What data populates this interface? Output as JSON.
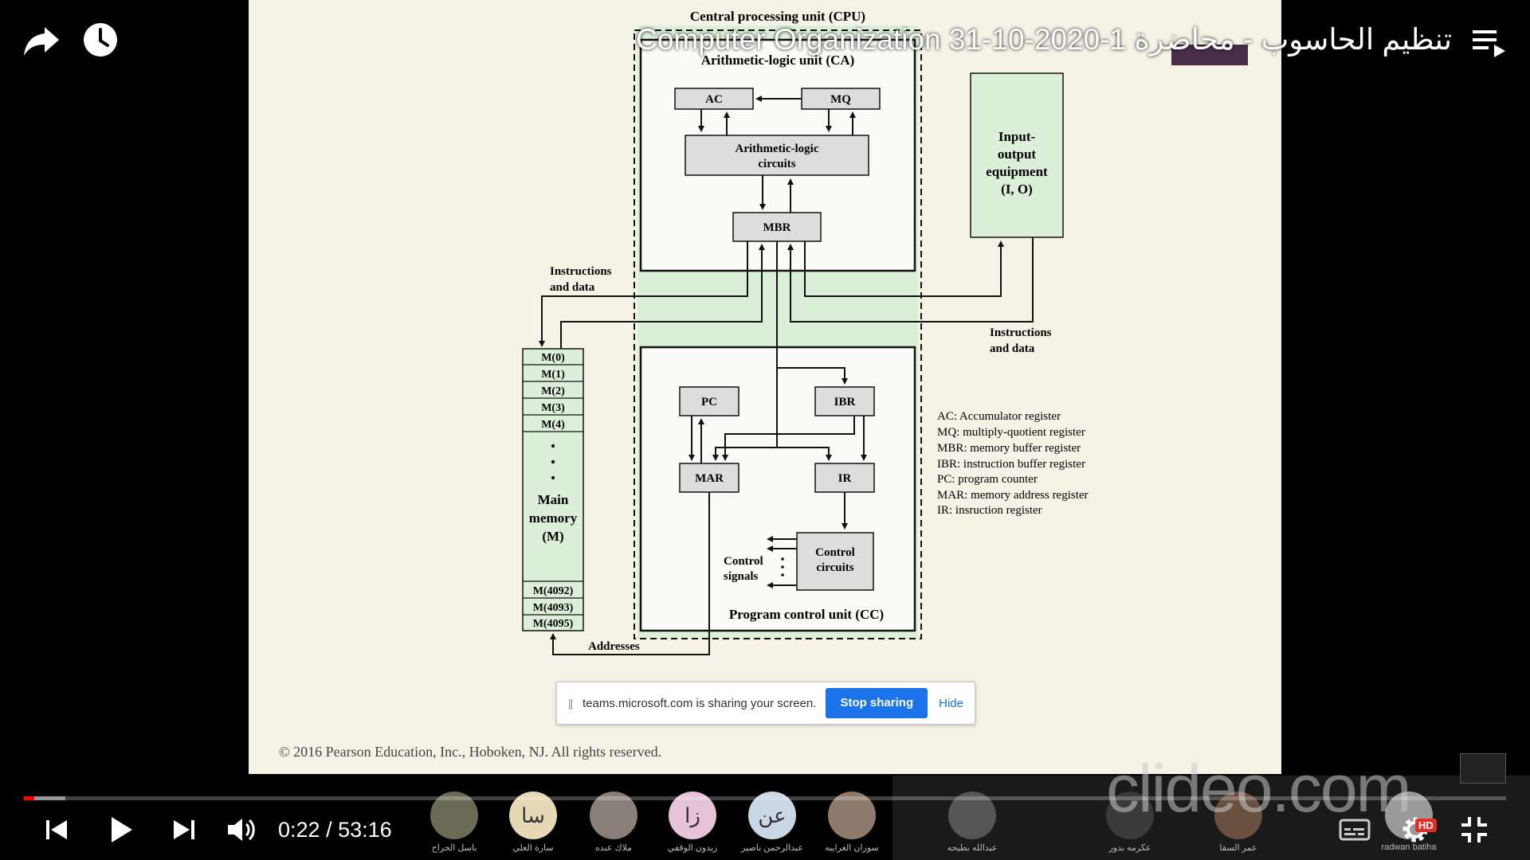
{
  "video": {
    "title": "Computer Organization تنظيم الحاسوب - محاضرة 1-2020-10-31",
    "current_time": "0:22",
    "duration": "53:16",
    "progress_fraction": 0.007,
    "buffered_fraction": 0.028
  },
  "icons": {
    "share": "share-arrow-icon",
    "watch_later": "clock-icon",
    "playlist": "playlist-icon",
    "prev": "skip-previous-icon",
    "play": "play-icon",
    "next": "skip-next-icon",
    "volume": "volume-icon",
    "captions": "subtitles-icon",
    "settings": "gear-icon",
    "exit_fullscreen": "exit-fullscreen-icon"
  },
  "hd_badge": "HD",
  "slide": {
    "cpu_label": "Central processing unit (CPU)",
    "alu_label": "Arithmetic-logic unit (CA)",
    "ac": "AC",
    "mq": "MQ",
    "alc_line1": "Arithmetic-logic",
    "alc_line2": "circuits",
    "mbr": "MBR",
    "io_line1": "Input-",
    "io_line2": "output",
    "io_line3": "equipment",
    "io_line4": "(I, O)",
    "instr_data_left_1": "Instructions",
    "instr_data_left_2": "and data",
    "instr_data_right_1": "Instructions",
    "instr_data_right_2": "and data",
    "memory_cells": [
      "M(0)",
      "M(1)",
      "M(2)",
      "M(3)",
      "M(4)"
    ],
    "memory_cells_end": [
      "M(4092)",
      "M(4093)",
      "M(4095)"
    ],
    "main_memory_1": "Main",
    "main_memory_2": "memory",
    "main_memory_3": "(M)",
    "pc": "PC",
    "ibr": "IBR",
    "mar": "MAR",
    "ir": "IR",
    "control_circuits_1": "Control",
    "control_circuits_2": "circuits",
    "control_signals_1": "Control",
    "control_signals_2": "signals",
    "pcu_label": "Program control unit (CC)",
    "addresses": "Addresses",
    "legend": [
      "AC: Accumulator register",
      "MQ: multiply-quotient register",
      "MBR: memory buffer register",
      "IBR: instruction buffer register",
      "PC: program counter",
      "MAR: memory address register",
      "IR: insruction register"
    ],
    "copyright": "© 2016 Pearson Education, Inc., Hoboken, NJ. All rights reserved."
  },
  "share_bar": {
    "message": "teams.microsoft.com is sharing your screen.",
    "stop_label": "Stop sharing",
    "hide_label": "Hide"
  },
  "watermark": "clideo.com",
  "participants": [
    {
      "initials": "",
      "name": "باسل الجراح",
      "color": "#6b6b55"
    },
    {
      "initials": "سا",
      "name": "سارة العلي",
      "color": "#e7d8b5"
    },
    {
      "initials": "",
      "name": "ملاك عبده",
      "color": "#8a7f78"
    },
    {
      "initials": "زا",
      "name": "زيدون الوقفي",
      "color": "#e6c3d6"
    },
    {
      "initials": "عن",
      "name": "عبدالرحمن ناصير",
      "color": "#c9d6e3"
    },
    {
      "initials": "",
      "name": "سوزان الغرايبه",
      "color": "#8d7a6a"
    },
    {
      "initials": "",
      "name": "عبدالله بطيحه",
      "color": "#555555"
    },
    {
      "initials": "",
      "name": "عكرمه بدور",
      "color": "#3a3a3a"
    },
    {
      "initials": "",
      "name": "عمر السقا",
      "color": "#6a5040"
    },
    {
      "initials": "",
      "name": "radwan batiha",
      "color": "#9a9a9a"
    }
  ]
}
